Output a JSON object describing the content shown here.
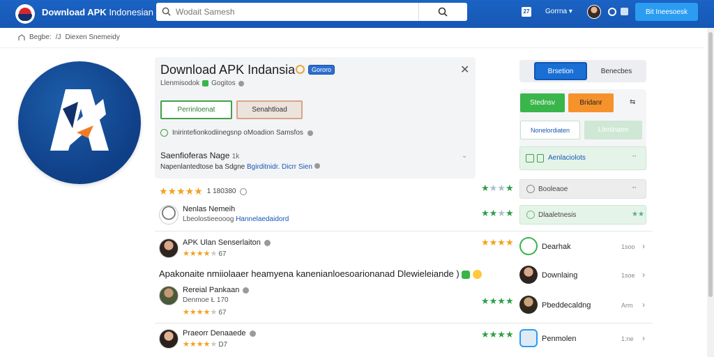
{
  "header": {
    "site_title_bold": "Download APK",
    "site_title_thin": "Indonesian",
    "search_placeholder": "Wodait Samesh",
    "calendar_icon_text": "27",
    "lang_label": "Gorrna ▾",
    "cta_label": "Bit Ineesoesk",
    "icons": [
      "logo",
      "search-icon",
      "calendar-icon",
      "avatar",
      "globe-icon",
      "square-icon"
    ]
  },
  "breadcrumb": {
    "icon": "home-icon",
    "items": [
      "Begbe:",
      "/J",
      "Diexen Snemeidy"
    ]
  },
  "app": {
    "title": "Download APK Indansia",
    "badge_label": "Gororo",
    "developer": "Llenmisodok",
    "developer_tag": "Gogitos",
    "install_label": "Perrinloenat",
    "download_label": "Senahtload",
    "info_text": "Inirintefionkodiinegsnp oMoadion Samsfos",
    "section_title": "Saenfioferas Nage",
    "section_count": "1k",
    "section_sub_a": "Napenlantedtose ba Sdgne",
    "section_sub_b": "Bgirditnidr. Dicrr Sien"
  },
  "rating": {
    "stars": 5,
    "count": "1 180380"
  },
  "reviews": [
    {
      "name": "Nenlas Nemeih",
      "meta_a": "Lbeolostieeooog",
      "meta_b": "Hannelaedaidord",
      "stars": 0,
      "num": ""
    },
    {
      "name": "APK Ulan Senserlaiton",
      "meta_a": "",
      "meta_b": "",
      "stars": 4,
      "num": "67"
    },
    {
      "name": "Rereial Pankaan",
      "meta_a": "Denmoe",
      "meta_b": "Ł 170",
      "stars": 4,
      "num": "67"
    },
    {
      "name": "Praeorr Denaaede",
      "meta_a": "",
      "meta_b": "",
      "stars": 4,
      "num": "D7"
    }
  ],
  "review_text": "Apakonaite nmiiolaaer heamyena kanenianloesoarionanad Dlewieleiande )",
  "right": {
    "tab_active": "Brsetion",
    "tab_inactive": "Benecbes",
    "btn_green": "Stednsv",
    "btn_orange": "Bridanr",
    "arrows": "⇆",
    "btn_outline": "Nonelordiaten",
    "btn_pale": "Llenlnaen",
    "panel_row_label": "Aenlaciolots",
    "item_grey_label": "Booleaoe",
    "item_green_label": "Dlaaletnesis",
    "downloads": [
      {
        "label": "Dearhak",
        "size": "1soo"
      },
      {
        "label": "Downlaing",
        "size": "1soe"
      },
      {
        "label": "Pbeddecaldng",
        "size": "Arm"
      },
      {
        "label": "Penmolen",
        "size": "1:ne"
      }
    ]
  },
  "colors": {
    "header_blue": "#1657b3",
    "accent_green": "#3ab54a",
    "accent_orange": "#f6922b",
    "star_orange": "#f2a11f",
    "star_green": "#2e9e46"
  }
}
